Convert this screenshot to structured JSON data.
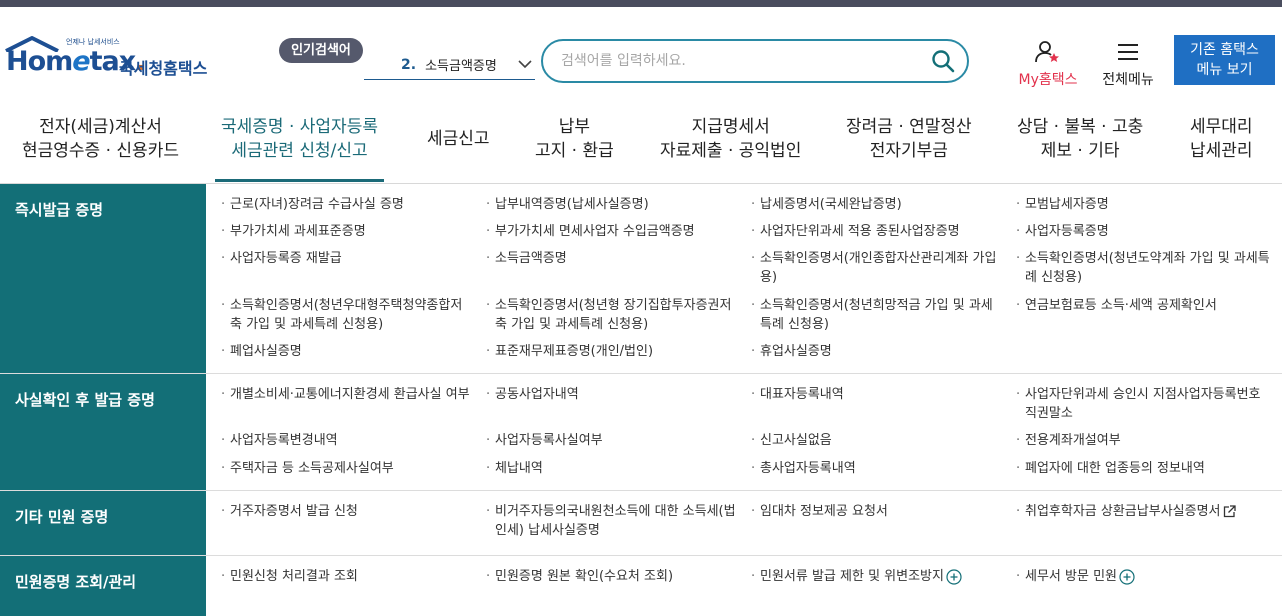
{
  "header": {
    "logo_tag": "언제나 납세서비스",
    "logo_brand_left": "Hom",
    "logo_brand_e": "e",
    "logo_brand_right": "tax",
    "logo_dot": ".",
    "logo_korean": "국세청홈택스",
    "popular_label": "인기검색어",
    "popular_rank": "2.",
    "popular_keyword": "소득금액증명",
    "search_placeholder": "검색어를 입력하세요.",
    "my_hometax": "My홈택스",
    "all_menu": "전체메뉴",
    "old_home_line1": "기존 홈택스",
    "old_home_line2": "메뉴 보기"
  },
  "nav": [
    {
      "line1": "전자(세금)계산서",
      "line2": "현금영수증 · 신용카드"
    },
    {
      "line1": "국세증명 · 사업자등록",
      "line2": "세금관련 신청/신고"
    },
    {
      "line1": "세금신고",
      "line2": ""
    },
    {
      "line1": "납부",
      "line2": "고지 · 환급"
    },
    {
      "line1": "지급명세서",
      "line2": "자료제출 · 공익법인"
    },
    {
      "line1": "장려금 · 연말정산",
      "line2": "전자기부금"
    },
    {
      "line1": "상담 · 불복 · 고충",
      "line2": "제보 · 기타"
    },
    {
      "line1": "세무대리",
      "line2": "납세관리"
    }
  ],
  "sections": [
    {
      "title": "즉시발급 증명",
      "items": [
        "근로(자녀)장려금 수급사실 증명",
        "납부내역증명(납세사실증명)",
        "납세증명서(국세완납증명)",
        "모범납세자증명",
        "부가가치세 과세표준증명",
        "부가가치세 면세사업자 수입금액증명",
        "사업자단위과세 적용 종된사업장증명",
        "사업자등록증명",
        "사업자등록증 재발급",
        "소득금액증명",
        "소득확인증명서(개인종합자산관리계좌 가입용)",
        "소득확인증명서(청년도약계좌 가입 및 과세특례 신청용)",
        "소득확인증명서(청년우대형주택청약종합저축 가입 및 과세특례 신청용)",
        "소득확인증명서(청년형 장기집합투자증권저축 가입 및 과세특례 신청용)",
        "소득확인증명서(청년희망적금 가입 및 과세특례 신청용)",
        "연금보험료등 소득·세액 공제확인서",
        "폐업사실증명",
        "표준재무제표증명(개인/법인)",
        "휴업사실증명"
      ]
    },
    {
      "title": "사실확인 후 발급 증명",
      "items": [
        "개별소비세·교통에너지환경세 환급사실 여부",
        "공동사업자내역",
        "대표자등록내역",
        "사업자단위과세 승인시 지점사업자등록번호 직권말소",
        "사업자등록변경내역",
        "사업자등록사실여부",
        "신고사실없음",
        "전용계좌개설여부",
        "주택자금 등 소득공제사실여부",
        "체납내역",
        "총사업자등록내역",
        "폐업자에 대한 업종등의 정보내역"
      ]
    },
    {
      "title": "기타 민원 증명",
      "items": [
        "거주자증명서 발급 신청",
        "비거주자등의국내원천소득에 대한 소득세(법인세) 납세사실증명",
        "임대차 정보제공 요청서",
        "취업후학자금 상환금납부사실증명서"
      ]
    },
    {
      "title": "민원증명 조회/관리",
      "items": [
        "민원신청 처리결과 조회",
        "민원증명 원본 확인(수요처 조회)",
        "민원서류 발급 제한 및 위변조방지",
        "세무서 방문 민원"
      ]
    }
  ],
  "colors": {
    "teal": "#136f77",
    "accent_blue": "#1f6fc3",
    "my_red": "#e2334d"
  }
}
